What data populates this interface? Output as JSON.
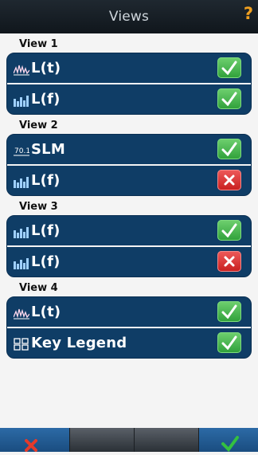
{
  "header": {
    "title": "Views",
    "help_icon": "question-mark-icon"
  },
  "views": [
    {
      "label": "View 1",
      "rows": [
        {
          "icon": "waveform-icon",
          "text": "L(t)",
          "enabled": true
        },
        {
          "icon": "spectrum-icon",
          "text": "L(f)",
          "enabled": true
        }
      ]
    },
    {
      "label": "View 2",
      "rows": [
        {
          "icon": "slm-icon",
          "text": "SLM",
          "enabled": true
        },
        {
          "icon": "spectrum-icon",
          "text": "L(f)",
          "enabled": false
        }
      ]
    },
    {
      "label": "View 3",
      "rows": [
        {
          "icon": "spectrum-icon",
          "text": "L(f)",
          "enabled": true
        },
        {
          "icon": "spectrum-icon",
          "text": "L(f)",
          "enabled": false
        }
      ]
    },
    {
      "label": "View 4",
      "rows": [
        {
          "icon": "waveform-icon",
          "text": "L(t)",
          "enabled": true
        },
        {
          "icon": "key-legend-icon",
          "text": "Key Legend",
          "enabled": true
        }
      ]
    }
  ],
  "footer": {
    "cancel_icon": "close-icon",
    "ok_icon": "check-icon"
  },
  "colors": {
    "enabled": "#3fb24a",
    "disabled": "#d42a2a",
    "row_bg": "#0f3d66",
    "cancel": "#e53a2a",
    "ok": "#34c040"
  }
}
